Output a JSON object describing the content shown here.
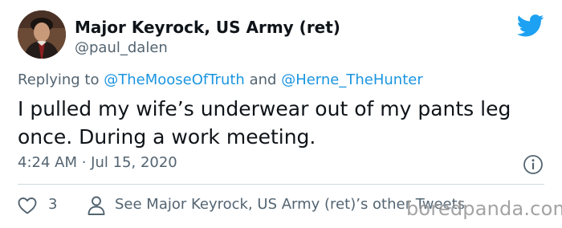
{
  "author": {
    "display_name": "Major Keyrock, US Army (ret)",
    "handle": "@paul_dalen"
  },
  "reply": {
    "prefix": "Replying to",
    "mention_1": "@TheMooseOfTruth",
    "conjunction": "and",
    "mention_2": "@Herne_TheHunter"
  },
  "tweet": {
    "text": "I pulled my wife’s underwear out of my pants leg once. During a work meeting.",
    "timestamp": "4:24 AM · Jul 15, 2020"
  },
  "actions": {
    "like_count": "3",
    "see_other_tweets": "See Major Keyrock, US Army (ret)’s other Tweets"
  },
  "watermark": {
    "text": "boredpanda.com"
  },
  "colors": {
    "twitter_blue": "#1da1f2",
    "mention": "#1b95e0",
    "secondary_text": "#536471",
    "divider": "#cfd9de"
  },
  "icons": [
    "avatar",
    "twitter-bird-icon",
    "info-icon",
    "heart-icon",
    "person-icon"
  ]
}
